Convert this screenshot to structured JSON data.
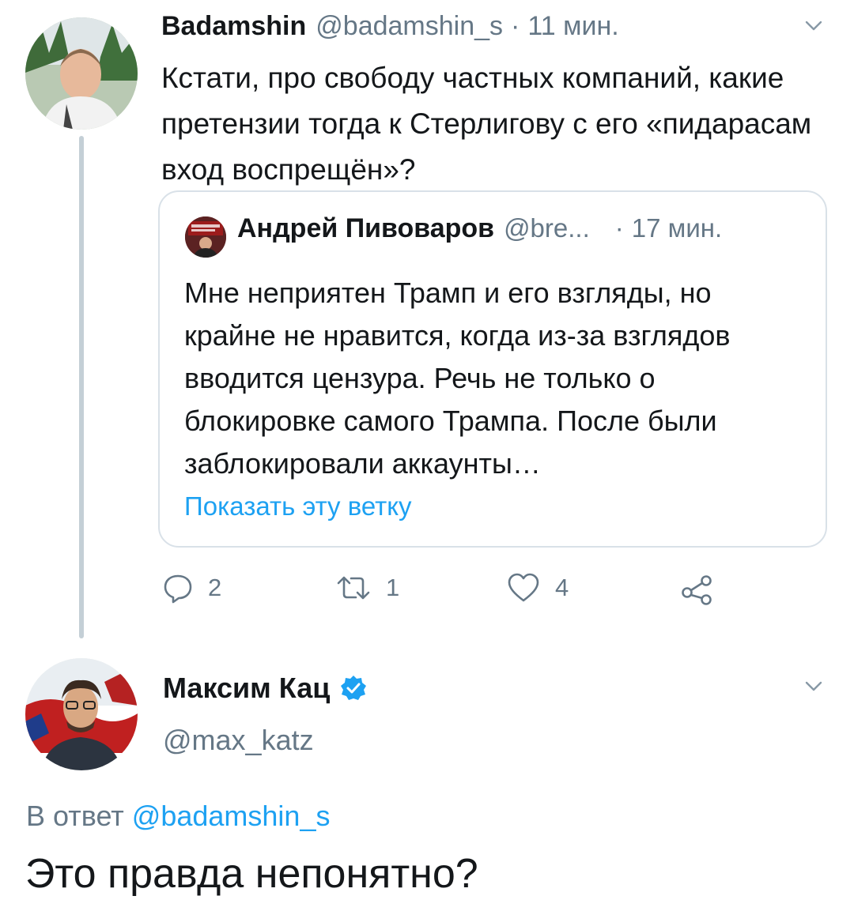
{
  "tweet1": {
    "name": "Badamshin",
    "handle": "@badamshin_s",
    "separator": "·",
    "time": "11 мин.",
    "text": "Кстати, про свободу частных компаний, какие претензии тогда к Стерлигову с его «пидарасам вход воспрещён»?",
    "menu_icon": "chevron-down-icon",
    "quote": {
      "name": "Андрей Пивоваров",
      "handle": "@bre...",
      "separator": "·",
      "time": "17 мин.",
      "text": "Мне неприятен Трамп и его взгляды, но крайне не нравится, когда из-за взглядов вводится цензура. Речь не только о блокировке самого Трампа. После были заблокировали аккаунты…",
      "show_thread": "Показать эту ветку"
    },
    "actions": {
      "replies": "2",
      "retweets": "1",
      "likes": "4"
    }
  },
  "tweet2": {
    "name": "Максим Кац",
    "handle": "@max_katz",
    "verified": true,
    "reply_prefix": "В ответ",
    "reply_to": "@badamshin_s",
    "text": "Это правда непонятно?"
  },
  "colors": {
    "accent": "#1da1f2",
    "secondary_text": "#657786",
    "primary_text": "#14171a",
    "border": "#d9e1e8",
    "thread_line": "#c4cfd6"
  }
}
